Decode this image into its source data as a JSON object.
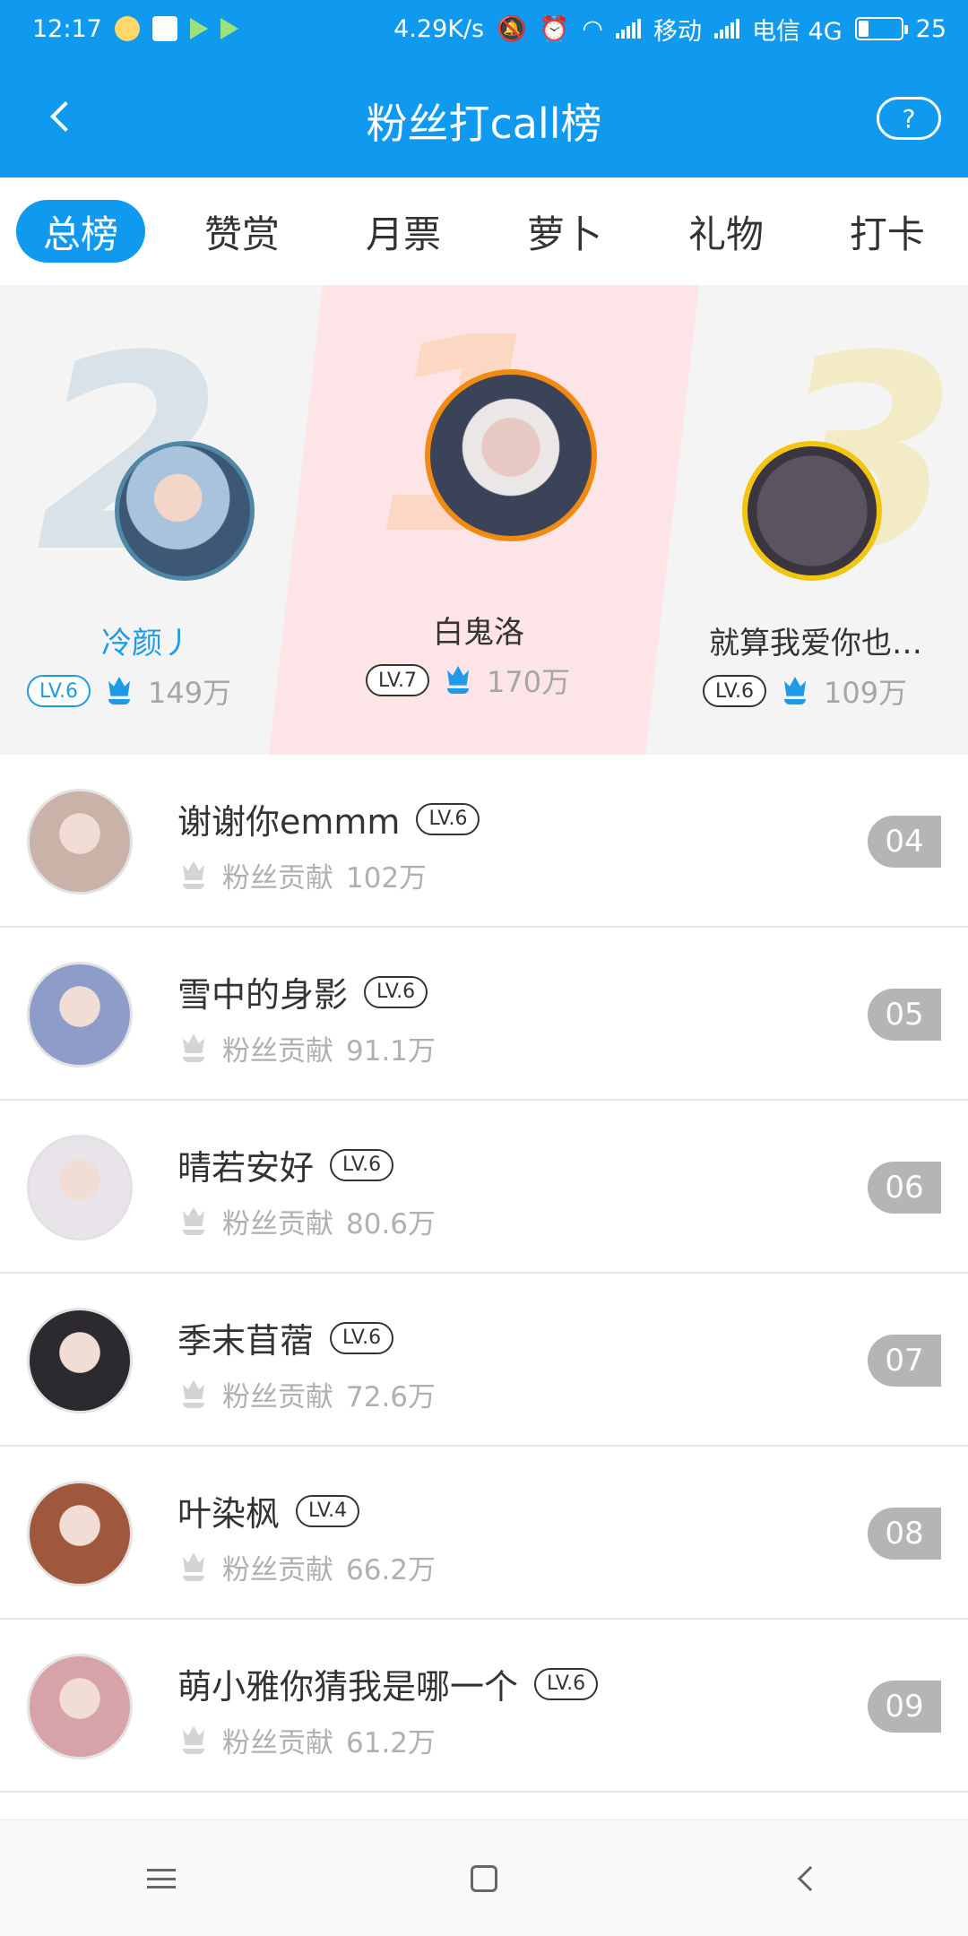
{
  "status_bar": {
    "time": "12:17",
    "net_speed": "4.29K/s",
    "carrier1": "移动",
    "carrier2": "电信 4G",
    "battery": "25"
  },
  "header": {
    "title": "粉丝打call榜",
    "help_label": "?"
  },
  "tabs": [
    {
      "label": "总榜",
      "active": true
    },
    {
      "label": "赞赏",
      "active": false
    },
    {
      "label": "月票",
      "active": false
    },
    {
      "label": "萝卜",
      "active": false
    },
    {
      "label": "礼物",
      "active": false
    },
    {
      "label": "打卡",
      "active": false
    }
  ],
  "podium": {
    "digits": [
      "2",
      "1",
      "3"
    ],
    "second": {
      "name": "冷颜丿",
      "level": "LV.6",
      "count": "149万"
    },
    "first": {
      "name": "白鬼洛",
      "level": "LV.7",
      "count": "170万"
    },
    "third": {
      "name": "就算我爱你也…",
      "level": "LV.6",
      "count": "109万"
    }
  },
  "contribution_label": "粉丝贡献",
  "list": [
    {
      "name": "谢谢你emmm",
      "level": "LV.6",
      "label": "粉丝贡献",
      "count": "102万",
      "rank": "04",
      "avatar_color": "#c9b2a8"
    },
    {
      "name": "雪中的身影",
      "level": "LV.6",
      "label": "粉丝贡献",
      "count": "91.1万",
      "rank": "05",
      "avatar_color": "#8e9cc9"
    },
    {
      "name": "晴若安好",
      "level": "LV.6",
      "label": "粉丝贡献",
      "count": "80.6万",
      "rank": "06",
      "avatar_color": "#e8e4ea"
    },
    {
      "name": "季末苜蓿",
      "level": "LV.6",
      "label": "粉丝贡献",
      "count": "72.6万",
      "rank": "07",
      "avatar_color": "#2c2a2e"
    },
    {
      "name": "叶染枫",
      "level": "LV.4",
      "label": "粉丝贡献",
      "count": "66.2万",
      "rank": "08",
      "avatar_color": "#a0583d"
    },
    {
      "name": "萌小雅你猜我是哪一个",
      "level": "LV.6",
      "label": "粉丝贡献",
      "count": "61.2万",
      "rank": "09",
      "avatar_color": "#d8a3a8"
    }
  ],
  "colors": {
    "accent": "#0f9af0",
    "rank_badge": "#b5b5b5",
    "first_ring": "#f08a10",
    "second_ring": "#4f88a6",
    "third_ring": "#f2c511"
  },
  "icons": {
    "back": "chevron-left-icon",
    "help": "question-icon",
    "contribution": "flower-icon",
    "nav_menu": "menu-icon",
    "nav_home": "home-icon",
    "nav_back": "back-icon"
  }
}
